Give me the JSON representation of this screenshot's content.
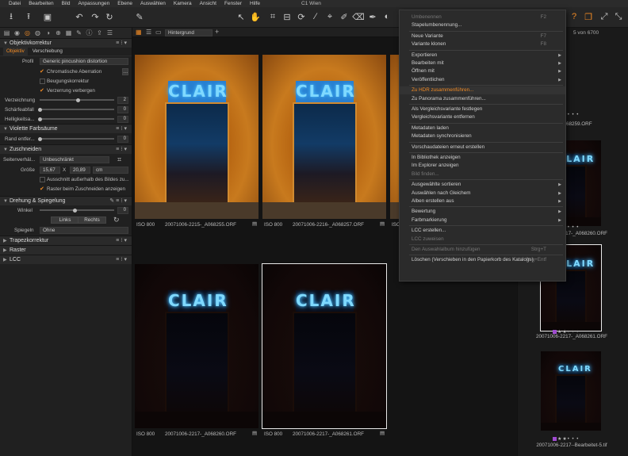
{
  "app": {
    "title": "C1 Wien",
    "menu": [
      "Datei",
      "Bearbeiten",
      "Bild",
      "Anpassungen",
      "Ebene",
      "Auswählen",
      "Kamera",
      "Ansicht",
      "Fenster",
      "Hilfe"
    ]
  },
  "toolbar": {
    "counter": "5 von 6700"
  },
  "left_panel": {
    "objektiv": {
      "title": "Objektivkorrektur",
      "tabs": [
        "Objektiv",
        "Verschiebung"
      ],
      "profil_label": "Profil",
      "profil_value": "Generic pincushion distortion",
      "chrom_aberration": "Chromatische Aberration",
      "beugung": "Beugungskorrektur",
      "verzerrung_verbergen": "Verzerrung verbergen",
      "verzeichnung_label": "Verzeichnung",
      "verzeichnung_value": "2",
      "schaerfe_label": "Schärfeabfall",
      "schaerfe_value": "0",
      "helligkeit_label": "Helligkeitsa...",
      "helligkeit_value": "0"
    },
    "violette": {
      "title": "Violette Farbsäume",
      "rand_label": "Rand entfer...",
      "rand_value": "0"
    },
    "zuschneiden": {
      "title": "Zuschneiden",
      "seiten_label": "Seitenverhäl...",
      "seiten_value": "Unbeschränkt",
      "groesse_label": "Größe",
      "w": "15,67",
      "x": "X",
      "h": "20,89",
      "unit": "cm",
      "ausschnitt": "Ausschnitt außerhalb des Bildes zu...",
      "raster": "Raster beim Zuschneiden anzeigen"
    },
    "drehung": {
      "title": "Drehung & Spiegelung",
      "winkel_label": "Winkel",
      "winkel_value": "0",
      "links": "Links",
      "rechts": "Rechts",
      "spiegeln_label": "Spiegeln",
      "spiegeln_value": "Ohne"
    },
    "collapsed": [
      "Trapezkorrektur",
      "Raster",
      "LCC"
    ]
  },
  "browser": {
    "variant_select": "Hintergrund",
    "thumbs": [
      {
        "iso": "ISO 800",
        "name": "20071006-2215-_A068255.ORF"
      },
      {
        "iso": "ISO 800",
        "name": "20071006-2216-_A068257.ORF"
      },
      {
        "iso": "ISO 800",
        "name": ""
      },
      {
        "iso": "ISO 800",
        "name": "20071006-2217-_A068260.ORF"
      },
      {
        "iso": "ISO 800",
        "name": "20071006-2217-_A068261.ORF"
      }
    ],
    "sign_text": "CLAIR"
  },
  "right_strip": {
    "items": [
      {
        "name": "...-_A068259.ORF"
      },
      {
        "name": "20071006-2217-_A068260.ORF"
      },
      {
        "name": "20071006-2217-_A068261.ORF"
      },
      {
        "name": "20071006-2217--Bearbeitet-5.tif"
      }
    ],
    "sign_text": "CLAIR"
  },
  "context_menu": {
    "items": [
      {
        "label": "Umbenennen",
        "shortcut": "F2",
        "disabled": true
      },
      {
        "label": "Stapelumbenennung...",
        "shortcut": "",
        "disabled": false
      },
      {
        "sep": true
      },
      {
        "label": "Neue Variante",
        "shortcut": "F7",
        "disabled": false
      },
      {
        "label": "Variante klonen",
        "shortcut": "F8",
        "disabled": false
      },
      {
        "sep": true
      },
      {
        "label": "Exportieren",
        "sub": true
      },
      {
        "label": "Bearbeiten mit",
        "sub": true
      },
      {
        "label": "Öffnen mit",
        "sub": true
      },
      {
        "label": "Veröffentlichen",
        "sub": true
      },
      {
        "sep": true
      },
      {
        "label": "Zu HDR zusammenführen...",
        "highlight": true
      },
      {
        "label": "Zu Panorama zusammenführen..."
      },
      {
        "sep": true
      },
      {
        "label": "Als Vergleichsvariante festlegen"
      },
      {
        "label": "Vergleichsvariante entfernen"
      },
      {
        "sep": true
      },
      {
        "label": "Metadaten laden"
      },
      {
        "label": "Metadaten synchronisieren"
      },
      {
        "sep": true
      },
      {
        "label": "Vorschaudateien erneut erstellen"
      },
      {
        "sep": true
      },
      {
        "label": "In Bibliothek anzeigen"
      },
      {
        "label": "Im Explorer anzeigen"
      },
      {
        "label": "Bild finden...",
        "disabled": true
      },
      {
        "sep": true
      },
      {
        "label": "Ausgewählte sortieren",
        "sub": true
      },
      {
        "label": "Auswählen nach Gleichem",
        "sub": true
      },
      {
        "label": "Alben erstellen aus",
        "sub": true
      },
      {
        "sep": true
      },
      {
        "label": "Bewertung",
        "sub": true
      },
      {
        "label": "Farbmarkierung",
        "sub": true
      },
      {
        "sep": true
      },
      {
        "label": "LCC erstellen..."
      },
      {
        "label": "LCC zuweisen",
        "disabled": true
      },
      {
        "sep": true
      },
      {
        "label": "Den Auswahlalbum hinzufügen",
        "shortcut": "Strg+T",
        "disabled": true
      },
      {
        "sep": true
      },
      {
        "label": "Löschen (Verschieben in den Papierkorb des Katalogs)",
        "shortcut": "Strg+Entf"
      }
    ]
  },
  "colors": {
    "accent": "#f08a24",
    "neon": "#4fc3ff"
  }
}
